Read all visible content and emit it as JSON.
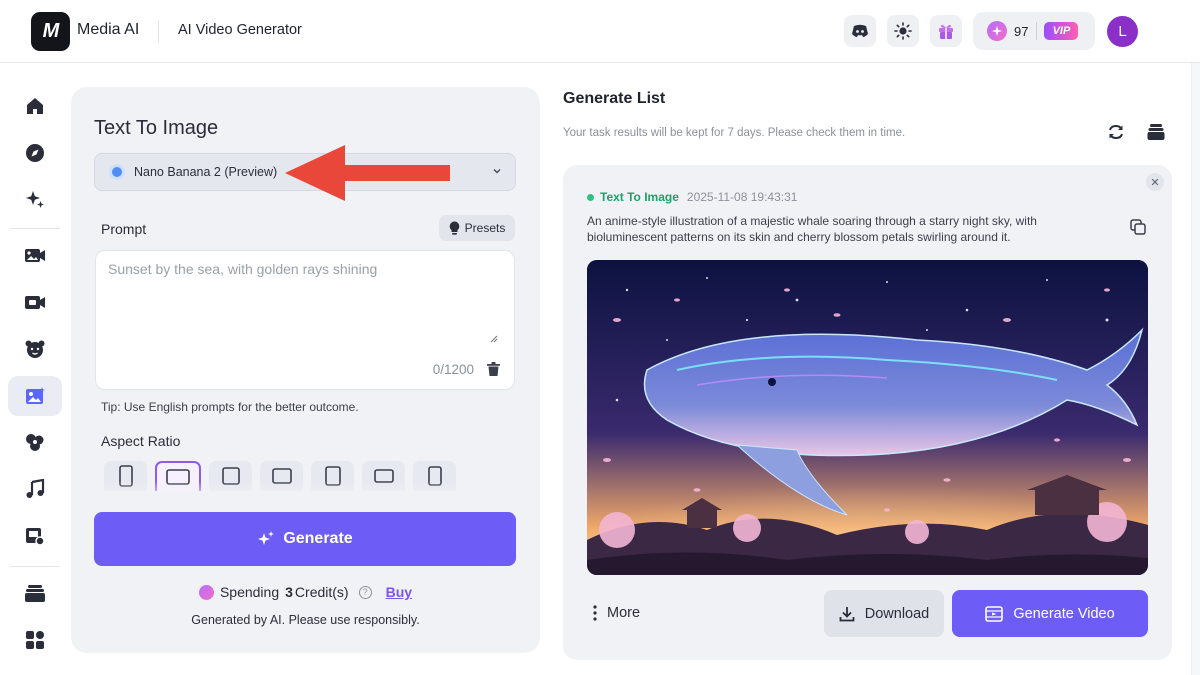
{
  "header": {
    "logo_text": "M",
    "brand": "Media AI",
    "page_title": "AI Video Generator",
    "credits": "97",
    "vip_label": "VIP",
    "avatar_initial": "L"
  },
  "sidebar": {
    "items": [
      "home-icon",
      "explore-icon",
      "sparkle-icon",
      "image-to-video-icon",
      "video-icon",
      "character-icon",
      "text-to-image-icon",
      "photo-edit-icon",
      "music-icon",
      "tools-icon",
      "library-icon",
      "apps-icon"
    ],
    "active": "text-to-image-icon"
  },
  "left_panel": {
    "title": "Text To Image",
    "model": "Nano Banana 2 (Preview)",
    "prompt_label": "Prompt",
    "presets_label": "Presets",
    "prompt_placeholder": "Sunset by the sea, with golden rays shining",
    "prompt_value": "",
    "counter": "0/1200",
    "tip": "Tip: Use English prompts for the better outcome.",
    "aspect_ratio_label": "Aspect Ratio",
    "generate_label": "Generate",
    "spending_prefix": "Spending",
    "spending_amount": "3",
    "spending_suffix": "Credit(s)",
    "buy_label": "Buy",
    "disclaimer": "Generated by AI. Please use responsibly."
  },
  "generate_list": {
    "title": "Generate List",
    "subtitle": "Your task results will be kept for 7 days. Please check them in time.",
    "task": {
      "type": "Text To Image",
      "time": "2025-11-08 19:43:31",
      "description": "An anime-style illustration of a majestic whale soaring through a starry night sky, with bioluminescent patterns on its skin and cherry blossom petals swirling around it."
    },
    "more_label": "More",
    "download_label": "Download",
    "generate_video_label": "Generate Video"
  },
  "colors": {
    "accent": "#6e5cf6",
    "annotation_arrow": "#e8473a",
    "status_green": "#1aa36c"
  }
}
